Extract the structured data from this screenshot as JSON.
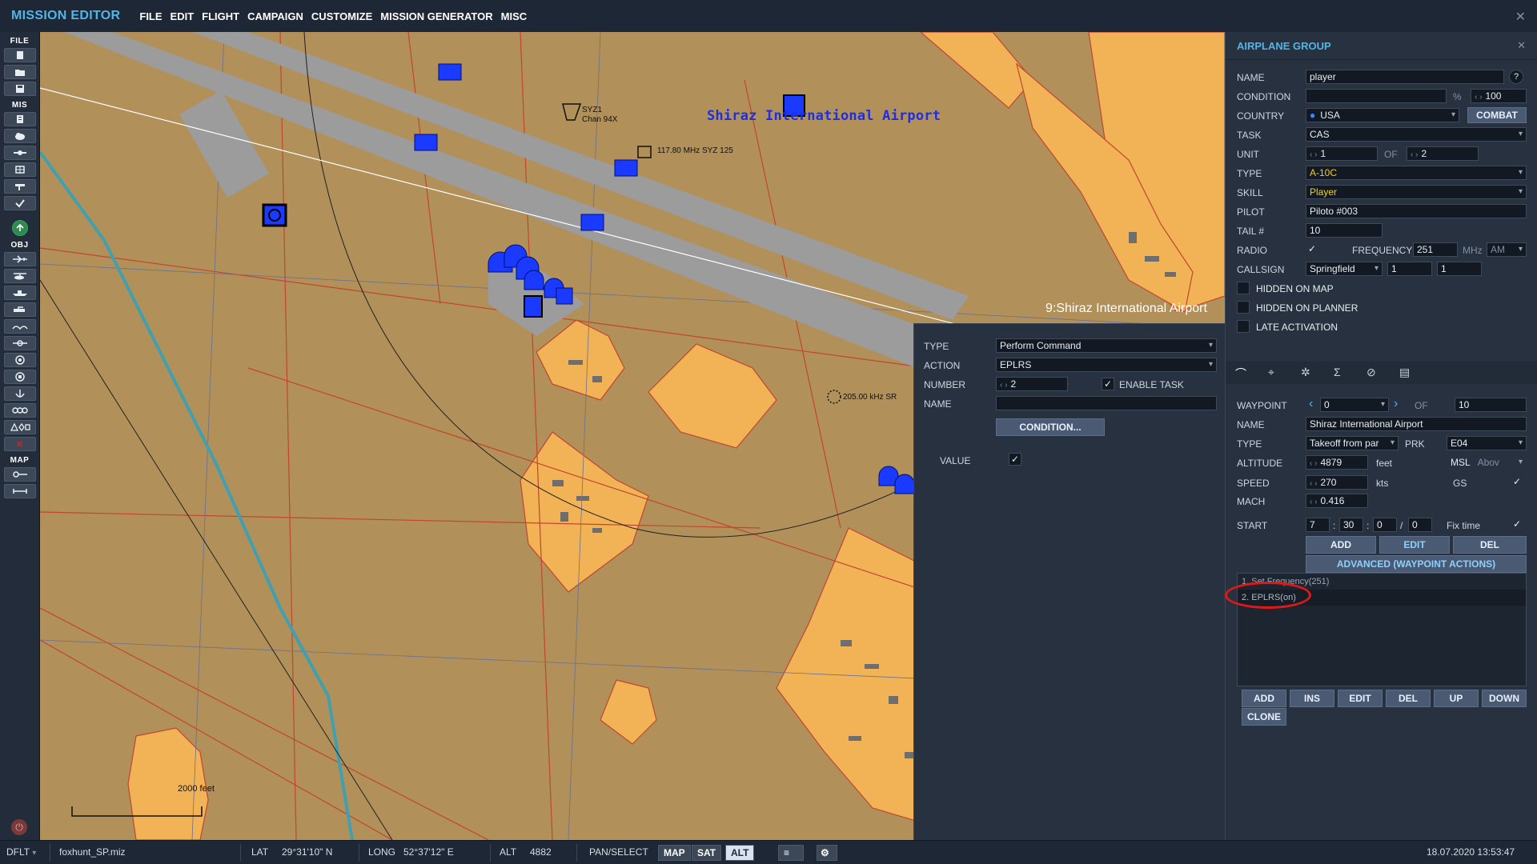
{
  "menubar": {
    "title": "MISSION EDITOR",
    "items": [
      "FILE",
      "EDIT",
      "FLIGHT",
      "CAMPAIGN",
      "CUSTOMIZE",
      "MISSION GENERATOR",
      "MISC"
    ],
    "close": "✕"
  },
  "toolbar": {
    "sections": [
      "FILE",
      "MIS",
      "OBJ",
      "MAP"
    ]
  },
  "map": {
    "airport_title": "Shiraz International Airport",
    "waypoint_label": "9:Shiraz International Airport",
    "labels": {
      "syz_name": "SYZ1",
      "syz_chan": "Chan 94X",
      "vor": "117.80 MHz SYZ 125",
      "ndb": "205.00 kHz SR"
    },
    "scale": "2000 feet",
    "colors": {
      "terrain": "#b1905a",
      "urban": "#f2b356",
      "runway": "#9c9c9c",
      "roads": "#c24530",
      "river": "#40a0b0",
      "units": "#1a3aff"
    }
  },
  "task_panel": {
    "type_label": "TYPE",
    "type_value": "Perform Command",
    "action_label": "ACTION",
    "action_value": "EPLRS",
    "number_label": "NUMBER",
    "number_value": "2",
    "enable_task_label": "ENABLE TASK",
    "name_label": "NAME",
    "name_value": "",
    "condition_button": "CONDITION...",
    "value_label": "VALUE"
  },
  "group_panel": {
    "title": "AIRPLANE GROUP",
    "close": "✕",
    "name_label": "NAME",
    "name_value": "player",
    "help": "?",
    "condition_label": "CONDITION",
    "condition_value": "",
    "condition_pct": "%",
    "condition_prob": "100",
    "country_label": "COUNTRY",
    "country_value": "USA",
    "combat_button": "COMBAT",
    "task_label": "TASK",
    "task_value": "CAS",
    "unit_label": "UNIT",
    "unit_value": "1",
    "unit_of": "OF",
    "unit_total": "2",
    "type_label": "TYPE",
    "type_value": "A-10C",
    "skill_label": "SKILL",
    "skill_value": "Player",
    "pilot_label": "PILOT",
    "pilot_value": "Piloto #003",
    "tail_label": "TAIL #",
    "tail_value": "10",
    "radio_label": "RADIO",
    "frequency_label": "FREQUENCY",
    "frequency_value": "251",
    "frequency_unit": "MHz",
    "modulation": "AM",
    "callsign_label": "CALLSIGN",
    "callsign_value": "Springfield",
    "callsign_num1": "1",
    "callsign_num2": "1",
    "hidden_map_label": "HIDDEN ON MAP",
    "hidden_planner_label": "HIDDEN ON PLANNER",
    "late_activation_label": "LATE ACTIVATION"
  },
  "waypoint_panel": {
    "waypoint_label": "WAYPOINT",
    "waypoint_value": "0",
    "waypoint_of": "OF",
    "waypoint_total": "10",
    "name_label": "NAME",
    "name_value": "Shiraz International Airport",
    "type_label": "TYPE",
    "type_value": "Takeoff from par",
    "prk_label": "PRK",
    "prk_value": "E04",
    "altitude_label": "ALTITUDE",
    "altitude_value": "4879",
    "altitude_unit": "feet",
    "altitude_ref": "MSL",
    "altitude_ref2": "Abov",
    "speed_label": "SPEED",
    "speed_value": "270",
    "speed_unit": "kts",
    "gs_label": "GS",
    "mach_label": "MACH",
    "mach_value": "0.416",
    "start_label": "START",
    "start_h": "7",
    "start_m": "30",
    "start_s": "0",
    "start_f": "0",
    "fix_time_label": "Fix time",
    "btn_add": "ADD",
    "btn_edit": "EDIT",
    "btn_del": "DEL",
    "advanced_button": "ADVANCED (WAYPOINT ACTIONS)",
    "actions": [
      "1. Set Frequency(251)",
      "2. EPLRS(on)"
    ],
    "list_buttons": [
      "ADD",
      "INS",
      "EDIT",
      "DEL",
      "UP",
      "DOWN"
    ],
    "clone_button": "CLONE"
  },
  "statusbar": {
    "mode": "DFLT",
    "file": "foxhunt_SP.miz",
    "lat_label": "LAT",
    "lat_value": "29°31'10\" N",
    "long_label": "LONG",
    "long_value": "52°37'12\" E",
    "alt_label": "ALT",
    "alt_value": "4882",
    "pan_label": "PAN/SELECT",
    "map_btn": "MAP",
    "sat_btn": "SAT",
    "alt_btn": "ALT",
    "datetime": "18.07.2020 13:53:47"
  }
}
